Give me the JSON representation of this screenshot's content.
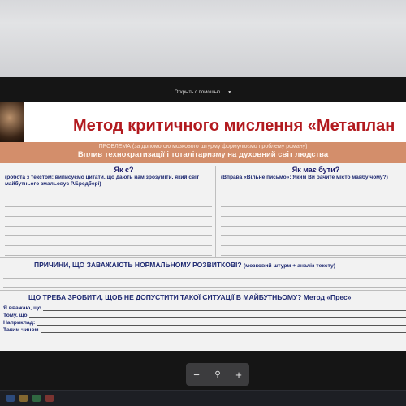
{
  "viewer": {
    "open_with_label": "Открыть с помощью...",
    "dropdown_icon": "chevron-down-icon"
  },
  "slide": {
    "title": "Метод критичного мислення «Метаплан",
    "problem": {
      "label": "ПРОБЛЕМА",
      "hint": "(за допомогою мозкового штурму формулюємо проблему роману)",
      "text": "Вплив технократизації і тоталітаризму на  духовний світ людства"
    },
    "left_column": {
      "title": "Як є?",
      "note": "(робота з текстом: виписуємо цитати, що дають нам зрозуміти, який світ майбутнього змальовує Р.Бредбері)"
    },
    "right_column": {
      "title": "Як має бути?",
      "note": "(Вправа «Вільне письмо»: Яким Ви бачите місто майбу чому?)"
    },
    "causes": {
      "title": "ПРИЧИНИ, ЩО ЗАВАЖАЮТЬ НОРМАЛЬНОМУ РОЗВИТКОВІ?",
      "note": "(мозковий штурм + аналіз тексту)"
    },
    "todo": {
      "title": "ЩО ТРЕБА ЗРОБИТИ, ЩОБ НЕ ДОПУСТИТИ ТАКОЇ СИТУАЦІЇ В МАЙБУТНЬОМУ? Метод «Прес»",
      "prompts": [
        "Я вважаю, що",
        "Тому, що",
        "Наприклад:",
        "Таким чином"
      ]
    }
  },
  "zoom": {
    "zoom_out_label": "−",
    "zoom_in_label": "+",
    "search_icon": "magnifier-icon"
  },
  "colors": {
    "title_red": "#b21a1f",
    "problem_bg": "#d38e6b",
    "text_navy": "#1f2a72"
  }
}
